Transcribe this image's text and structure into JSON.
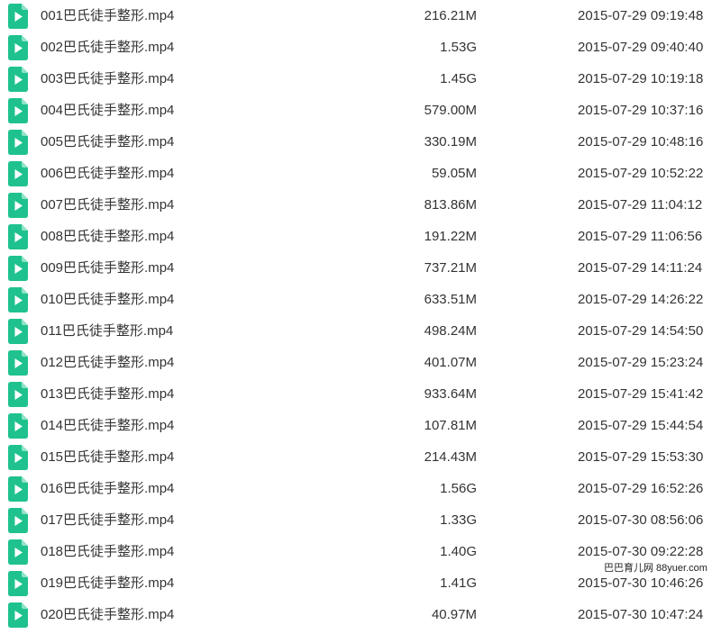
{
  "colors": {
    "icon_bg": "#1fc28e",
    "icon_glyph": "#ffffff",
    "text": "#333333"
  },
  "files": [
    {
      "icon": "video-file-icon",
      "name": "001巴氏徒手整形.mp4",
      "size": "216.21M",
      "date": "2015-07-29 09:19:48"
    },
    {
      "icon": "video-file-icon",
      "name": "002巴氏徒手整形.mp4",
      "size": "1.53G",
      "date": "2015-07-29 09:40:40"
    },
    {
      "icon": "video-file-icon",
      "name": "003巴氏徒手整形.mp4",
      "size": "1.45G",
      "date": "2015-07-29 10:19:18"
    },
    {
      "icon": "video-file-icon",
      "name": "004巴氏徒手整形.mp4",
      "size": "579.00M",
      "date": "2015-07-29 10:37:16"
    },
    {
      "icon": "video-file-icon",
      "name": "005巴氏徒手整形.mp4",
      "size": "330.19M",
      "date": "2015-07-29 10:48:16"
    },
    {
      "icon": "video-file-icon",
      "name": "006巴氏徒手整形.mp4",
      "size": "59.05M",
      "date": "2015-07-29 10:52:22"
    },
    {
      "icon": "video-file-icon",
      "name": "007巴氏徒手整形.mp4",
      "size": "813.86M",
      "date": "2015-07-29 11:04:12"
    },
    {
      "icon": "video-file-icon",
      "name": "008巴氏徒手整形.mp4",
      "size": "191.22M",
      "date": "2015-07-29 11:06:56"
    },
    {
      "icon": "video-file-icon",
      "name": "009巴氏徒手整形.mp4",
      "size": "737.21M",
      "date": "2015-07-29 14:11:24"
    },
    {
      "icon": "video-file-icon",
      "name": "010巴氏徒手整形.mp4",
      "size": "633.51M",
      "date": "2015-07-29 14:26:22"
    },
    {
      "icon": "video-file-icon",
      "name": "011巴氏徒手整形.mp4",
      "size": "498.24M",
      "date": "2015-07-29 14:54:50"
    },
    {
      "icon": "video-file-icon",
      "name": "012巴氏徒手整形.mp4",
      "size": "401.07M",
      "date": "2015-07-29 15:23:24"
    },
    {
      "icon": "video-file-icon",
      "name": "013巴氏徒手整形.mp4",
      "size": "933.64M",
      "date": "2015-07-29 15:41:42"
    },
    {
      "icon": "video-file-icon",
      "name": "014巴氏徒手整形.mp4",
      "size": "107.81M",
      "date": "2015-07-29 15:44:54"
    },
    {
      "icon": "video-file-icon",
      "name": "015巴氏徒手整形.mp4",
      "size": "214.43M",
      "date": "2015-07-29 15:53:30"
    },
    {
      "icon": "video-file-icon",
      "name": "016巴氏徒手整形.mp4",
      "size": "1.56G",
      "date": "2015-07-29 16:52:26"
    },
    {
      "icon": "video-file-icon",
      "name": "017巴氏徒手整形.mp4",
      "size": "1.33G",
      "date": "2015-07-30 08:56:06"
    },
    {
      "icon": "video-file-icon",
      "name": "018巴氏徒手整形.mp4",
      "size": "1.40G",
      "date": "2015-07-30 09:22:28"
    },
    {
      "icon": "video-file-icon",
      "name": "019巴氏徒手整形.mp4",
      "size": "1.41G",
      "date": "2015-07-30 10:46:26"
    },
    {
      "icon": "video-file-icon",
      "name": "020巴氏徒手整形.mp4",
      "size": "40.97M",
      "date": "2015-07-30 10:47:24"
    }
  ],
  "watermark": "巴巴育儿网 88yuer.com"
}
